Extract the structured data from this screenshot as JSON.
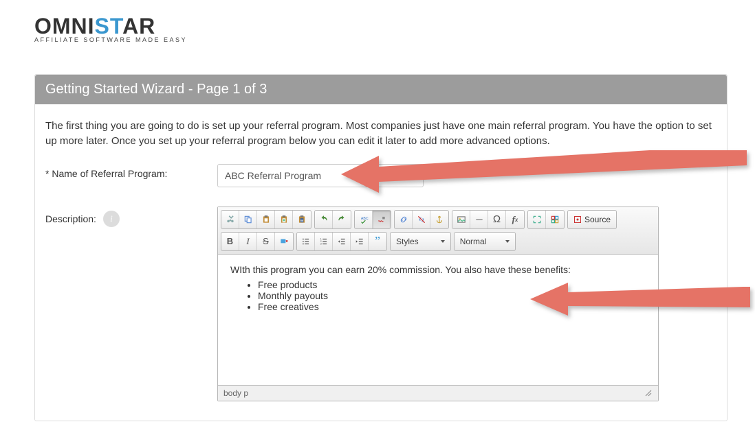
{
  "logo": {
    "part1": "OMNI",
    "part2": "ST",
    "part3": "AR",
    "tagline": "AFFILIATE SOFTWARE MADE EASY"
  },
  "panel": {
    "heading": "Getting Started Wizard - Page 1 of 3",
    "intro": "The first thing you are going to do is set up your referral program. Most companies just have one main referral program. You have the option to set up more later. Once you set up your referral program below you can edit it later to add more advanced options."
  },
  "form": {
    "name_label": "* Name of Referral Program:",
    "name_value": "ABC Referral Program",
    "description_label": "Description:"
  },
  "editor": {
    "styles_label": "Styles",
    "format_label": "Normal",
    "source_label": "Source",
    "body_intro": "WIth this program you can earn 20% commission. You also have these benefits:",
    "bullets": [
      "Free products",
      "Monthly payouts",
      "Free creatives"
    ],
    "path": "body   p"
  },
  "icons": {
    "cut": "cut",
    "copy": "copy",
    "paste": "paste",
    "paste_text": "paste_text",
    "paste_word": "paste_word",
    "undo": "undo",
    "redo": "redo",
    "spell": "spell",
    "spell2": "spell2",
    "link": "link",
    "unlink": "unlink",
    "anchor": "anchor",
    "image": "image",
    "hr": "hr",
    "special": "special",
    "fx": "fx",
    "maximize": "maximize",
    "blocks": "blocks",
    "bold": "B",
    "italic": "I",
    "strike": "S",
    "remove": "remove",
    "ul": "ul",
    "ol": "ol",
    "outdent": "outdent",
    "indent": "indent",
    "quote": "quote"
  }
}
